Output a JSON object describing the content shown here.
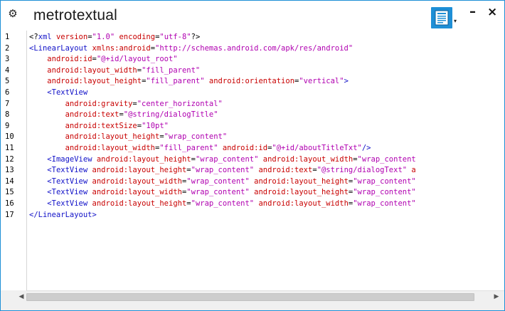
{
  "window": {
    "title": "metrotextual"
  },
  "icons": {
    "settings": "gear-icon",
    "document": "document-icon",
    "caret": "caret-down-icon"
  },
  "controls": {
    "minimize": "–",
    "close": "×",
    "gear": "⚙",
    "caret": "▾",
    "scroll_left": "◀",
    "scroll_right": "▶"
  },
  "colors": {
    "accent": "#1e8fd6",
    "tag": "#1010c8",
    "attr": "#c80000",
    "string": "#b000b0"
  },
  "editor": {
    "line_numbers": [
      "1",
      "2",
      "3",
      "4",
      "5",
      "6",
      "7",
      "8",
      "9",
      "10",
      "11",
      "12",
      "13",
      "14",
      "15",
      "16",
      "17"
    ],
    "lines": [
      [
        {
          "t": "p",
          "v": "<?"
        },
        {
          "t": "tag",
          "v": "xml"
        },
        {
          "t": "p",
          "v": " "
        },
        {
          "t": "attr",
          "v": "version"
        },
        {
          "t": "p",
          "v": "="
        },
        {
          "t": "str",
          "v": "\"1.0\""
        },
        {
          "t": "p",
          "v": " "
        },
        {
          "t": "attr",
          "v": "encoding"
        },
        {
          "t": "p",
          "v": "="
        },
        {
          "t": "str",
          "v": "\"utf-8\""
        },
        {
          "t": "p",
          "v": "?>"
        }
      ],
      [
        {
          "t": "tag",
          "v": "<LinearLayout"
        },
        {
          "t": "p",
          "v": " "
        },
        {
          "t": "attr",
          "v": "xmlns:android"
        },
        {
          "t": "p",
          "v": "="
        },
        {
          "t": "str",
          "v": "\"http://schemas.android.com/apk/res/android\""
        }
      ],
      [
        {
          "t": "p",
          "v": "    "
        },
        {
          "t": "attr",
          "v": "android:id"
        },
        {
          "t": "p",
          "v": "="
        },
        {
          "t": "str",
          "v": "\"@+id/layout_root\""
        }
      ],
      [
        {
          "t": "p",
          "v": "    "
        },
        {
          "t": "attr",
          "v": "android:layout_width"
        },
        {
          "t": "p",
          "v": "="
        },
        {
          "t": "str",
          "v": "\"fill_parent\""
        }
      ],
      [
        {
          "t": "p",
          "v": "    "
        },
        {
          "t": "attr",
          "v": "android:layout_height"
        },
        {
          "t": "p",
          "v": "="
        },
        {
          "t": "str",
          "v": "\"fill_parent\""
        },
        {
          "t": "p",
          "v": " "
        },
        {
          "t": "attr",
          "v": "android:orientation"
        },
        {
          "t": "p",
          "v": "="
        },
        {
          "t": "str",
          "v": "\"vertical\""
        },
        {
          "t": "tag",
          "v": ">"
        }
      ],
      [
        {
          "t": "p",
          "v": "    "
        },
        {
          "t": "tag",
          "v": "<TextView"
        }
      ],
      [
        {
          "t": "p",
          "v": "        "
        },
        {
          "t": "attr",
          "v": "android:gravity"
        },
        {
          "t": "p",
          "v": "="
        },
        {
          "t": "str",
          "v": "\"center_horizontal\""
        }
      ],
      [
        {
          "t": "p",
          "v": "        "
        },
        {
          "t": "attr",
          "v": "android:text"
        },
        {
          "t": "p",
          "v": "="
        },
        {
          "t": "str",
          "v": "\"@string/dialogTitle\""
        }
      ],
      [
        {
          "t": "p",
          "v": "        "
        },
        {
          "t": "attr",
          "v": "android:textSize"
        },
        {
          "t": "p",
          "v": "="
        },
        {
          "t": "str",
          "v": "\"10pt\""
        }
      ],
      [
        {
          "t": "p",
          "v": "        "
        },
        {
          "t": "attr",
          "v": "android:layout_height"
        },
        {
          "t": "p",
          "v": "="
        },
        {
          "t": "str",
          "v": "\"wrap_content\""
        }
      ],
      [
        {
          "t": "p",
          "v": "        "
        },
        {
          "t": "attr",
          "v": "android:layout_width"
        },
        {
          "t": "p",
          "v": "="
        },
        {
          "t": "str",
          "v": "\"fill_parent\""
        },
        {
          "t": "p",
          "v": " "
        },
        {
          "t": "attr",
          "v": "android:id"
        },
        {
          "t": "p",
          "v": "="
        },
        {
          "t": "str",
          "v": "\"@+id/aboutTitleTxt\""
        },
        {
          "t": "tag",
          "v": "/>"
        }
      ],
      [
        {
          "t": "p",
          "v": "    "
        },
        {
          "t": "tag",
          "v": "<ImageView"
        },
        {
          "t": "p",
          "v": " "
        },
        {
          "t": "attr",
          "v": "android:layout_height"
        },
        {
          "t": "p",
          "v": "="
        },
        {
          "t": "str",
          "v": "\"wrap_content\""
        },
        {
          "t": "p",
          "v": " "
        },
        {
          "t": "attr",
          "v": "android:layout_width"
        },
        {
          "t": "p",
          "v": "="
        },
        {
          "t": "str",
          "v": "\"wrap_content"
        }
      ],
      [
        {
          "t": "p",
          "v": "    "
        },
        {
          "t": "tag",
          "v": "<TextView"
        },
        {
          "t": "p",
          "v": " "
        },
        {
          "t": "attr",
          "v": "android:layout_height"
        },
        {
          "t": "p",
          "v": "="
        },
        {
          "t": "str",
          "v": "\"wrap_content\""
        },
        {
          "t": "p",
          "v": " "
        },
        {
          "t": "attr",
          "v": "android:text"
        },
        {
          "t": "p",
          "v": "="
        },
        {
          "t": "str",
          "v": "\"@string/dialogText\""
        },
        {
          "t": "p",
          "v": " "
        },
        {
          "t": "attr",
          "v": "a"
        }
      ],
      [
        {
          "t": "p",
          "v": "    "
        },
        {
          "t": "tag",
          "v": "<TextView"
        },
        {
          "t": "p",
          "v": " "
        },
        {
          "t": "attr",
          "v": "android:layout_width"
        },
        {
          "t": "p",
          "v": "="
        },
        {
          "t": "str",
          "v": "\"wrap_content\""
        },
        {
          "t": "p",
          "v": " "
        },
        {
          "t": "attr",
          "v": "android:layout_height"
        },
        {
          "t": "p",
          "v": "="
        },
        {
          "t": "str",
          "v": "\"wrap_content\""
        }
      ],
      [
        {
          "t": "p",
          "v": "    "
        },
        {
          "t": "tag",
          "v": "<TextView"
        },
        {
          "t": "p",
          "v": " "
        },
        {
          "t": "attr",
          "v": "android:layout_width"
        },
        {
          "t": "p",
          "v": "="
        },
        {
          "t": "str",
          "v": "\"wrap_content\""
        },
        {
          "t": "p",
          "v": " "
        },
        {
          "t": "attr",
          "v": "android:layout_height"
        },
        {
          "t": "p",
          "v": "="
        },
        {
          "t": "str",
          "v": "\"wrap_content\""
        }
      ],
      [
        {
          "t": "p",
          "v": "    "
        },
        {
          "t": "tag",
          "v": "<TextView"
        },
        {
          "t": "p",
          "v": " "
        },
        {
          "t": "attr",
          "v": "android:layout_height"
        },
        {
          "t": "p",
          "v": "="
        },
        {
          "t": "str",
          "v": "\"wrap_content\""
        },
        {
          "t": "p",
          "v": " "
        },
        {
          "t": "attr",
          "v": "android:layout_width"
        },
        {
          "t": "p",
          "v": "="
        },
        {
          "t": "str",
          "v": "\"wrap_content\""
        }
      ],
      [
        {
          "t": "tag",
          "v": "</LinearLayout>"
        }
      ]
    ]
  }
}
